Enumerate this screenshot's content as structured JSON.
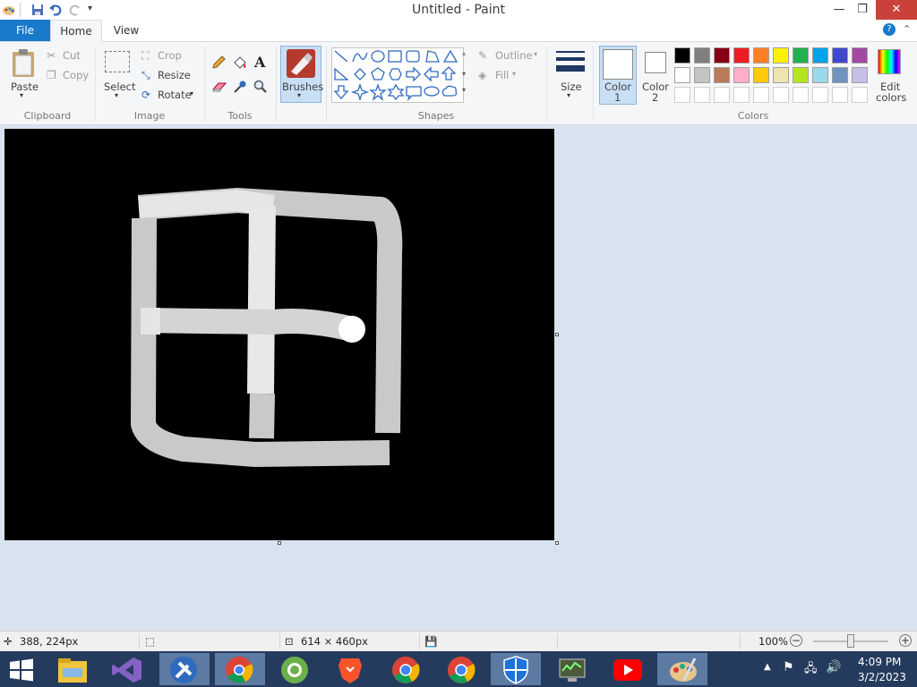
{
  "window": {
    "title": "Untitled - Paint"
  },
  "tabs": {
    "file": "File",
    "home": "Home",
    "view": "View"
  },
  "clipboard": {
    "paste": "Paste",
    "cut": "Cut",
    "copy": "Copy",
    "group": "Clipboard"
  },
  "image": {
    "select": "Select",
    "crop": "Crop",
    "resize": "Resize",
    "rotate": "Rotate",
    "group": "Image"
  },
  "tools": {
    "group": "Tools",
    "text_tool": "A"
  },
  "brushes": {
    "label": "Brushes"
  },
  "shapes": {
    "outline": "Outline",
    "fill": "Fill",
    "group": "Shapes"
  },
  "size": {
    "label": "Size"
  },
  "colors": {
    "color1": "Color\n1",
    "color1_a": "Color",
    "color1_b": "1",
    "color2_a": "Color",
    "color2_b": "2",
    "edit_a": "Edit",
    "edit_b": "colors",
    "group": "Colors",
    "row1": [
      "#000000",
      "#7f7f7f",
      "#880015",
      "#ed1c24",
      "#ff7f27",
      "#fff200",
      "#22b14c",
      "#00a2e8",
      "#3f48cc",
      "#a349a4"
    ],
    "row2": [
      "#ffffff",
      "#c3c3c3",
      "#b97a57",
      "#ffaec9",
      "#ffc90e",
      "#efe4b0",
      "#b5e61d",
      "#99d9ea",
      "#7092be",
      "#c8bfe7"
    ]
  },
  "status": {
    "cursor": "388, 224px",
    "canvas_size": "614 × 460px",
    "zoom": "100%",
    "zoom_level": 0.5
  },
  "tray": {
    "time": "4:09 PM",
    "date": "3/2/2023"
  }
}
